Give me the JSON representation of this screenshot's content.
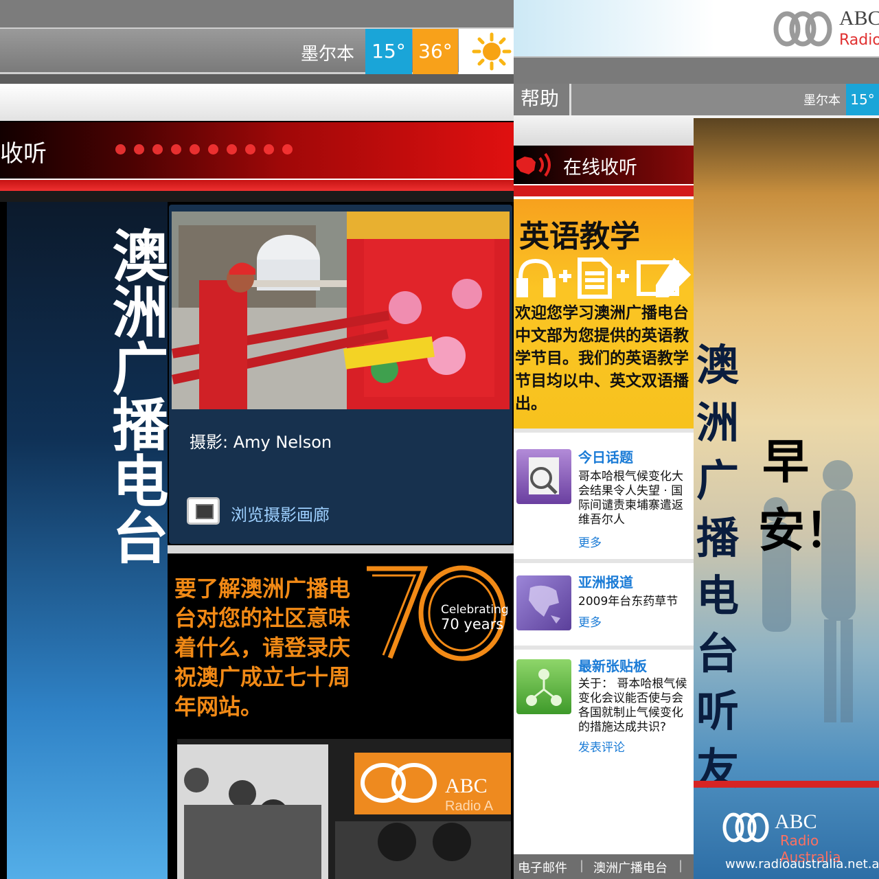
{
  "left": {
    "weather": {
      "city": "墨尔本",
      "temp_low": "15°",
      "temp_high": "36°"
    },
    "listen_label": "收听",
    "side_title": "澳洲广播电台",
    "photo_caption": "摄影: Amy Nelson",
    "gallery_link": "浏览摄影画廊",
    "promo_text": "要了解澳洲广播电台对您的社区意味着什么，请登录庆祝澳广成立七十周年网站。",
    "promo_number": "70",
    "promo_celebrating": "Celebrating",
    "promo_years": "70 years",
    "promo_logo_abc": "ABC",
    "promo_logo_radio": "Radio A"
  },
  "right": {
    "logo_abc": "ABC",
    "logo_radio": "Radio",
    "help": "帮助",
    "weather": {
      "city": "墨尔本",
      "temp_low": "15°"
    },
    "live_label": "在线收听",
    "english": {
      "title": "英语教学",
      "icons": "🎧+📄+✍",
      "body": "欢迎您学习澳洲广播电台中文部为您提供的英语教学节目。我们的英语教学节目均以中、英文双语播出。"
    },
    "items": [
      {
        "title": "今日话题",
        "body": "哥本哈根气候变化大会结果令人失望 · 国际间谴责柬埔寨遣返维吾尔人",
        "more": "更多"
      },
      {
        "title": "亚洲报道",
        "body": "2009年台东药草节",
        "more": "更多"
      },
      {
        "title": "最新张贴板",
        "body": "关于： 哥本哈根气候变化会议能否使与会各国就制止气候变化的措施达成共识?",
        "more": "发表评论"
      }
    ],
    "footer": {
      "email": "电子邮件",
      "station": "澳洲广播电台"
    },
    "poster": {
      "vertical_1": "澳洲广播电台听友",
      "vertical_2": "早安！",
      "abc": "ABC",
      "radio_australia": "Radio Australia",
      "url": "www.radioaustralia.net.au"
    }
  },
  "colors": {
    "accent_red": "#d31b1b",
    "accent_blue": "#1aa5d8",
    "accent_orange": "#f8a11a",
    "link_blue": "#1a7bd6"
  }
}
